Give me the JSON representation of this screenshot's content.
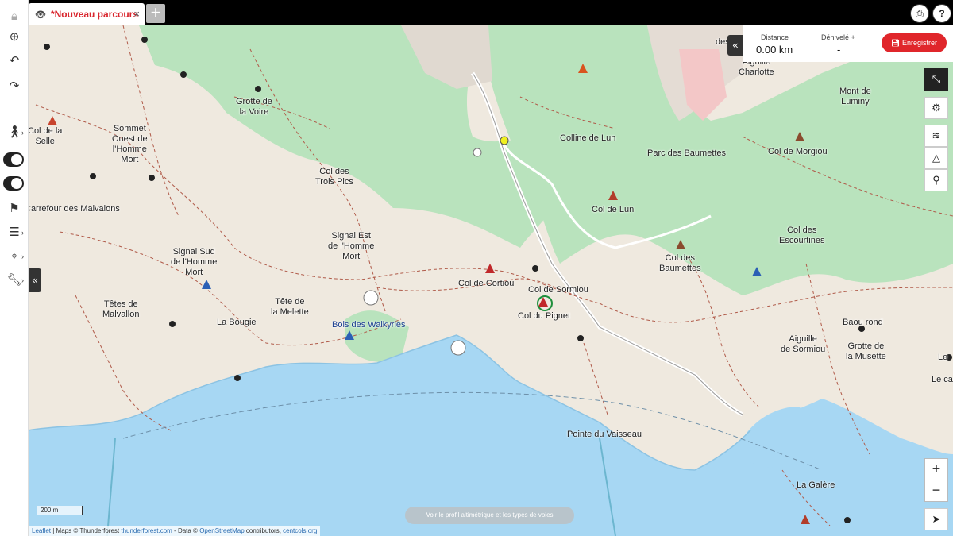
{
  "tab": {
    "title": "*Nouveau parcours",
    "close": "×",
    "add": "+"
  },
  "toolbar_icons": {
    "print": "print-icon",
    "help": "help-icon",
    "lock": "lock-icon",
    "zoom_search": "search-zoom-icon",
    "undo": "undo-icon",
    "redo": "redo-icon",
    "walk": "walk-icon",
    "layers_toggle": "route-toggle",
    "view_toggle": "eye-toggle",
    "flag": "flag-icon",
    "menu": "menu-icon",
    "pin": "pin-icon",
    "wrench": "wrench-icon"
  },
  "top_right": {
    "print": "⎙",
    "help": "?"
  },
  "stats": {
    "distance_label": "Distance",
    "distance_value": "0.00 km",
    "elevation_label": "Dénivelé +",
    "elevation_value": "-",
    "save_label": "Enregistrer"
  },
  "map_labels": [
    {
      "text": "Col de la\nSelle",
      "type": "normal"
    },
    {
      "text": "Sommet\nOuest de\nl'Homme\nMort",
      "type": "normal"
    },
    {
      "text": "Grotte de\nla Voire",
      "type": "normal"
    },
    {
      "text": "Col des\nTrois Pics",
      "type": "normal"
    },
    {
      "text": "Colline de Lun",
      "type": "normal"
    },
    {
      "text": "Parc des Baumettes",
      "type": "normal"
    },
    {
      "text": "Aiguille\nCharlotte",
      "type": "normal"
    },
    {
      "text": "Mont de\nLuminy",
      "type": "normal"
    },
    {
      "text": "Col de Morgiou",
      "type": "normal"
    },
    {
      "text": "Carrefour des Malvalons",
      "type": "normal"
    },
    {
      "text": "Col de Lun",
      "type": "normal"
    },
    {
      "text": "Col des\nEscourtines",
      "type": "normal"
    },
    {
      "text": "Signal Est\nde l'Homme\nMort",
      "type": "normal"
    },
    {
      "text": "Signal Sud\nde l'Homme\nMort",
      "type": "normal"
    },
    {
      "text": "Col des\nBaumettes",
      "type": "normal"
    },
    {
      "text": "Col de Cortiou",
      "type": "normal"
    },
    {
      "text": "Col de Sormiou",
      "type": "normal"
    },
    {
      "text": "Col du Pignet",
      "type": "normal"
    },
    {
      "text": "Têtes de\nMalvallon",
      "type": "normal"
    },
    {
      "text": "Tête de\nla Melette",
      "type": "normal"
    },
    {
      "text": "La Bougie",
      "type": "normal"
    },
    {
      "text": "Bois des Walkyries",
      "type": "blue"
    },
    {
      "text": "Baou rond",
      "type": "normal"
    },
    {
      "text": "Aiguille\nde Sormiou",
      "type": "normal"
    },
    {
      "text": "Grotte de\nla Musette",
      "type": "normal"
    },
    {
      "text": "Pointe du Vaisseau",
      "type": "normal"
    },
    {
      "text": "La Galère",
      "type": "normal"
    },
    {
      "text": "Le ca",
      "type": "normal"
    },
    {
      "text": "des",
      "type": "normal"
    },
    {
      "text": "Le",
      "type": "normal"
    }
  ],
  "scale_bar": "200 m",
  "profile_button": "Voir le profil altimétrique et les types de voies",
  "attribution": {
    "leaflet": "Leaflet",
    "maps": " | Maps © Thunderforest ",
    "tf": "thunderforest.com",
    "data": " - Data © ",
    "osm": "OpenStreetMap",
    "contrib": " contributors, ",
    "cc": "centcols.org"
  },
  "zoom": {
    "in": "+",
    "out": "−"
  },
  "colors": {
    "forest": "#b9e3bd",
    "sea": "#a7d7f3",
    "land": "#efe9df",
    "accent": "#e0262b",
    "trail": "#b05b4a"
  }
}
